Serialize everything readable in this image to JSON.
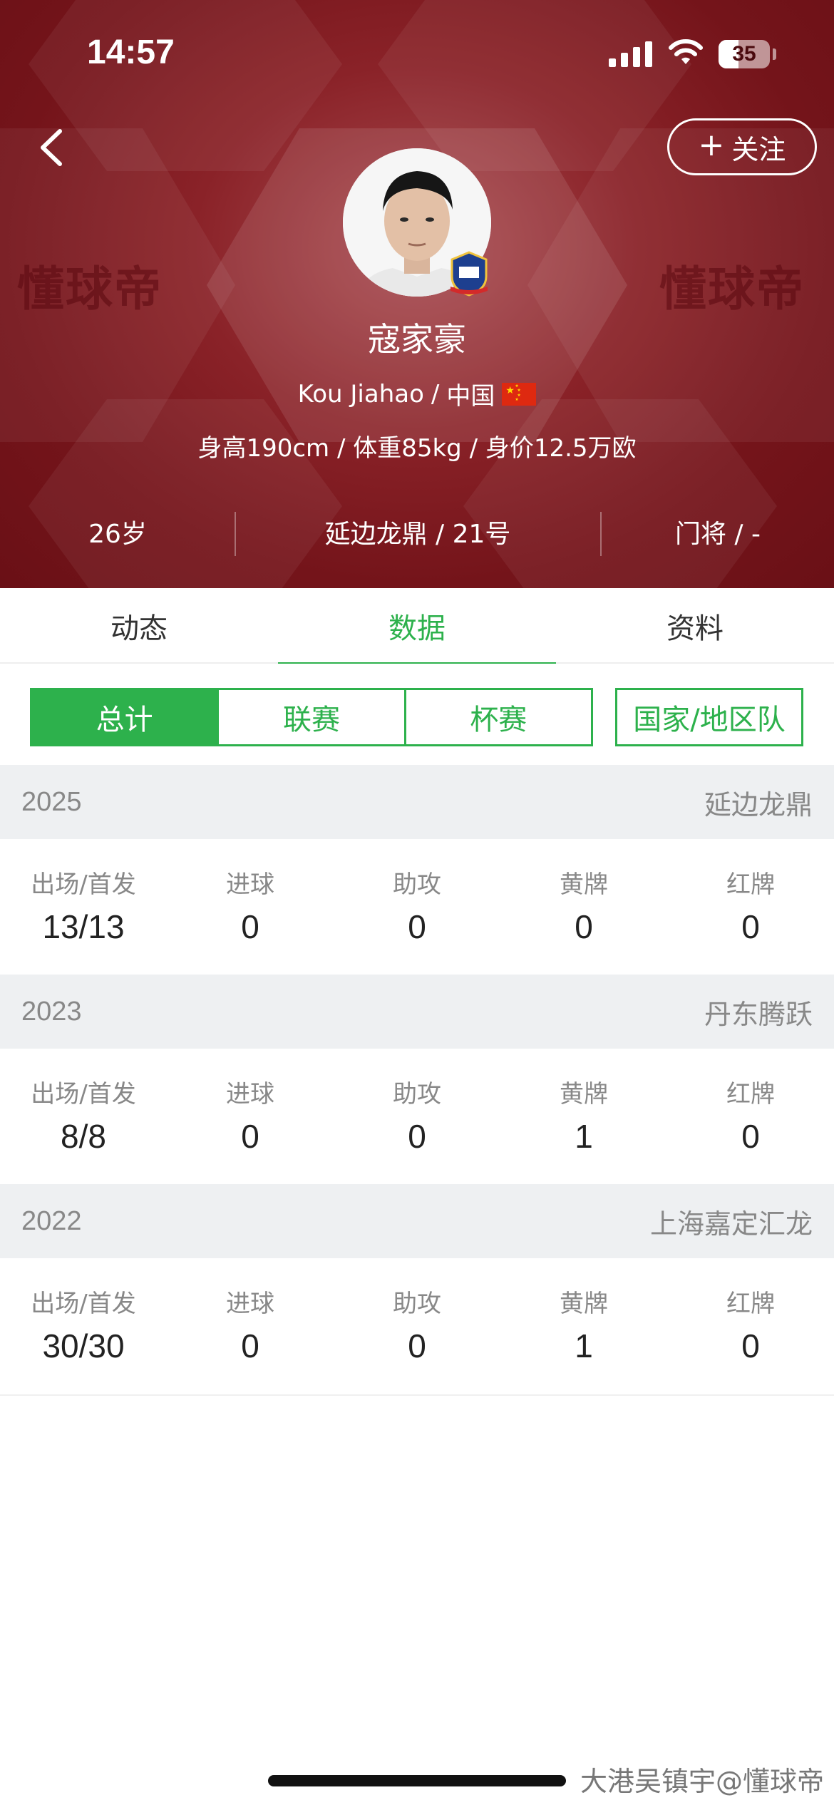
{
  "status_bar": {
    "time": "14:57",
    "battery": "35"
  },
  "header": {
    "follow_label": "关注",
    "watermark": "懂球帝",
    "player": {
      "name": "寇家豪",
      "english_name": "Kou Jiahao",
      "country": "中国",
      "physical": "身高190cm / 体重85kg / 身价12.5万欧",
      "age": "26岁",
      "team_number": "延边龙鼎 / 21号",
      "position": "门将 / -"
    }
  },
  "tabs": [
    "动态",
    "数据",
    "资料"
  ],
  "active_tab": 1,
  "filters": {
    "segments": [
      "总计",
      "联赛",
      "杯赛"
    ],
    "single": "国家/地区队",
    "active": 0
  },
  "stat_labels": [
    "出场/首发",
    "进球",
    "助攻",
    "黄牌",
    "红牌"
  ],
  "seasons": [
    {
      "year": "2025",
      "team": "延边龙鼎",
      "values": [
        "13/13",
        "0",
        "0",
        "0",
        "0"
      ]
    },
    {
      "year": "2023",
      "team": "丹东腾跃",
      "values": [
        "8/8",
        "0",
        "0",
        "1",
        "0"
      ]
    },
    {
      "year": "2022",
      "team": "上海嘉定汇龙",
      "values": [
        "30/30",
        "0",
        "0",
        "1",
        "0"
      ]
    }
  ],
  "credit": "大港吴镇宇@懂球帝",
  "colors": {
    "header_red": "#74141a",
    "accent_green": "#2db14c"
  }
}
